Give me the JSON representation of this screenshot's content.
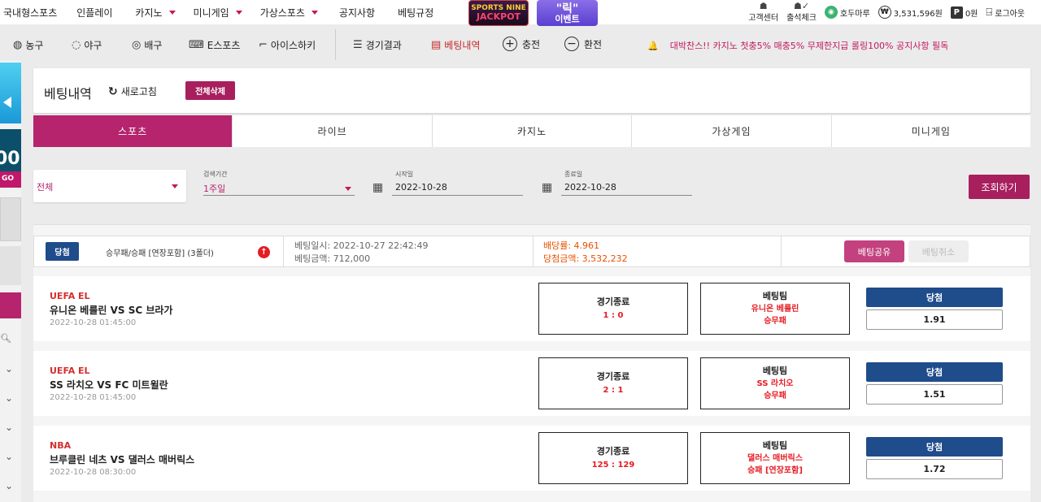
{
  "topnav": {
    "items": [
      "국내형스포츠",
      "인플레이",
      "카지노",
      "미니게임",
      "가상스포츠",
      "공지사항",
      "베팅규정"
    ],
    "banner_jackpot": [
      "SPORTS NINE",
      "JACKPOT"
    ],
    "banner_event": [
      "\"릭\"",
      "이벤트"
    ],
    "user": {
      "support": "고객센터",
      "attendance": "출석체크",
      "username": "호두마루",
      "balance": "3,531,596원",
      "points": "0원",
      "logout": "로그아웃",
      "won_symbol": "₩",
      "point_symbol": "P"
    }
  },
  "subnav": {
    "sports": [
      "농구",
      "야구",
      "배구",
      "E스포츠",
      "아이스하키"
    ],
    "results": "경기결과",
    "bet_history": "베팅내역",
    "deposit": "충전",
    "withdraw": "환전",
    "ticker": "대박찬스!! 카지노 첫충5% 매충5% 무제한지급 롤링100% 공지사항 필독"
  },
  "sidebar": {
    "badge_number": "00",
    "badge_text": "GO"
  },
  "page": {
    "title": "베팅내역",
    "refresh": "새로고침",
    "delete_all": "전체삭제"
  },
  "tabs": [
    "스포츠",
    "라이브",
    "카지노",
    "가상게임",
    "미니게임"
  ],
  "filter": {
    "type_value": "전체",
    "period_label": "검색기간",
    "period_value": "1주일",
    "start_label": "시작일",
    "start_value": "2022-10-28",
    "end_label": "종료일",
    "end_value": "2022-10-28",
    "search_button": "조회하기"
  },
  "bet": {
    "status": "당첨",
    "type": "승무패/승패 [연장포함] (3폴더)",
    "bet_time": "베팅일시: 2022-10-27 22:42:49",
    "bet_amount": "베팅금액: 712,000",
    "odds": "배당률: 4.961",
    "win_amount": "당첨금액: 3,532,232",
    "share_button": "베팅공유",
    "cancel_button": "베팅취소"
  },
  "matches": [
    {
      "league": "UEFA EL",
      "teams": "유니온 베를린 VS SC 브라가",
      "date": "2022-10-28 01:45:00",
      "result_title": "경기종료",
      "score": "1 : 0",
      "pick_title": "베팅팀",
      "pick_team": "유니온 베를린",
      "pick_market": "승무패",
      "status": "당첨",
      "odds": "1.91"
    },
    {
      "league": "UEFA EL",
      "teams": "SS 라치오 VS FC 미트윌란",
      "date": "2022-10-28 01:45:00",
      "result_title": "경기종료",
      "score": "2 : 1",
      "pick_title": "베팅팀",
      "pick_team": "SS 라치오",
      "pick_market": "승무패",
      "status": "당첨",
      "odds": "1.51"
    },
    {
      "league": "NBA",
      "teams": "브루클린 네츠 VS 댈러스 매버릭스",
      "date": "2022-10-28 08:30:00",
      "result_title": "경기종료",
      "score": "125 : 129",
      "pick_title": "베팅팀",
      "pick_team": "댈러스 매버릭스",
      "pick_market": "승패 [연장포함]",
      "status": "당첨",
      "odds": "1.72"
    }
  ],
  "colors": {
    "accent": "#b5246d",
    "win_blue": "#1f4c8a",
    "score_red": "#e51c23"
  }
}
